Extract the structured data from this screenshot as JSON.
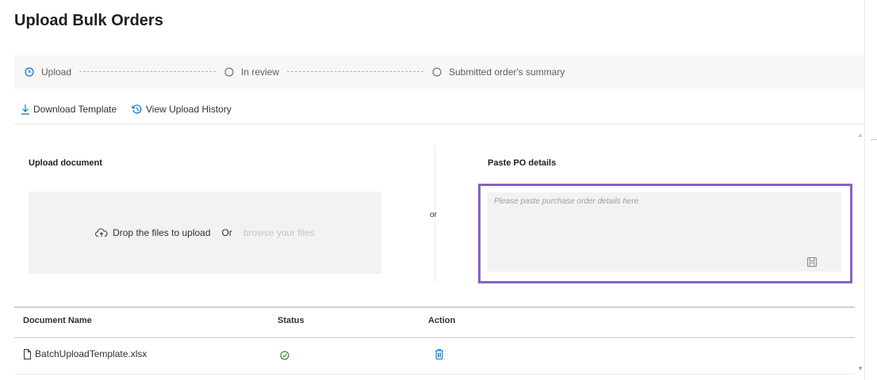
{
  "page": {
    "title": "Upload Bulk Orders"
  },
  "stepper": {
    "steps": [
      {
        "label": "Upload",
        "state": "current",
        "icon": "clock-icon"
      },
      {
        "label": "In review",
        "state": "pending",
        "icon": "circle-icon"
      },
      {
        "label": "Submitted order's summary",
        "state": "pending",
        "icon": "circle-icon"
      }
    ]
  },
  "toolbar": {
    "download_label": "Download Template",
    "history_label": "View Upload History"
  },
  "upload": {
    "title": "Upload document",
    "drop_text": "Drop the files to upload",
    "or_text": "Or",
    "browse_text": "browse your files"
  },
  "separator": {
    "or_label": "or"
  },
  "paste": {
    "title": "Paste PO details",
    "placeholder": "Please paste purchase order details here",
    "value": ""
  },
  "table": {
    "headers": [
      "Document Name",
      "Status",
      "Action"
    ],
    "rows": [
      {
        "name": "BatchUploadTemplate.xlsx",
        "status": "success",
        "action": "delete"
      }
    ]
  },
  "colors": {
    "accent": "#0078d4",
    "highlight": "#8661c5",
    "success": "#107c10",
    "panel": "#f3f2f1"
  }
}
